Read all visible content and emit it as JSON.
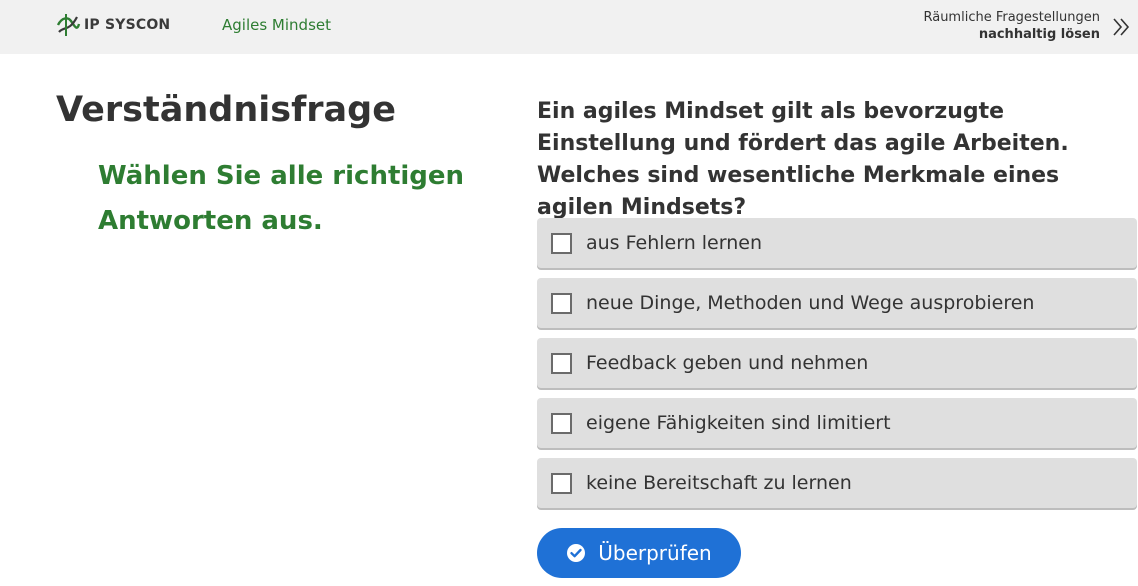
{
  "header": {
    "logo_text": "IP SYSCON",
    "course_title": "Agiles Mindset",
    "slogan_line1": "Räumliche Fragestellungen",
    "slogan_line2": "nachhaltig lösen",
    "next_icon": "double-chevron-right-icon",
    "logo_color": "#2e7d32"
  },
  "left": {
    "heading": "Verständnisfrage",
    "instruction": "Wählen Sie alle richtigen Antworten aus."
  },
  "quiz": {
    "question": "Ein agiles Mindset gilt als bevorzugte Einstellung und fördert das agile Arbeiten. Welches sind wesentliche Merkmale eines agilen Mindsets?",
    "answers": [
      {
        "label": "aus Fehlern lernen",
        "checked": false
      },
      {
        "label": "neue Dinge, Methoden und Wege ausprobieren",
        "checked": false
      },
      {
        "label": "Feedback geben und nehmen",
        "checked": false
      },
      {
        "label": "eigene Fähigkeiten sind limitiert",
        "checked": false
      },
      {
        "label": "keine Bereitschaft zu lernen",
        "checked": false
      }
    ],
    "check_button_label": "Überprüfen",
    "check_button_icon": "check-circle-icon"
  },
  "colors": {
    "accent_green": "#2e7d32",
    "button_blue": "#1f71d6",
    "answer_bg": "#dfdfdf"
  }
}
